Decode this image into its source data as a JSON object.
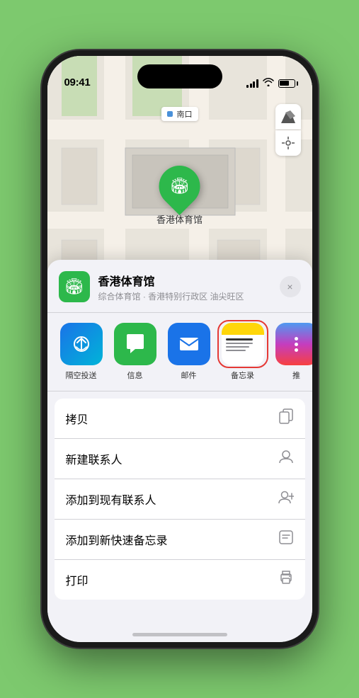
{
  "status_bar": {
    "time": "09:41",
    "location_arrow": "▶"
  },
  "map": {
    "label_text": "南口",
    "venue_pin_label": "香港体育馆"
  },
  "venue_card": {
    "name": "香港体育馆",
    "subtitle": "综合体育馆 · 香港特别行政区 油尖旺区",
    "close_label": "×"
  },
  "share_apps": [
    {
      "id": "airdrop",
      "label": "隔空投送",
      "icon": "📡"
    },
    {
      "id": "messages",
      "label": "信息",
      "icon": "💬"
    },
    {
      "id": "mail",
      "label": "邮件",
      "icon": "✉️"
    },
    {
      "id": "notes",
      "label": "备忘录",
      "icon": ""
    },
    {
      "id": "more",
      "label": "推",
      "icon": ""
    }
  ],
  "actions": [
    {
      "id": "copy",
      "label": "拷贝",
      "icon": "⎘"
    },
    {
      "id": "new-contact",
      "label": "新建联系人",
      "icon": "👤"
    },
    {
      "id": "add-existing",
      "label": "添加到现有联系人",
      "icon": "👤"
    },
    {
      "id": "quick-note",
      "label": "添加到新快速备忘录",
      "icon": "⊞"
    },
    {
      "id": "print",
      "label": "打印",
      "icon": "🖨"
    }
  ]
}
